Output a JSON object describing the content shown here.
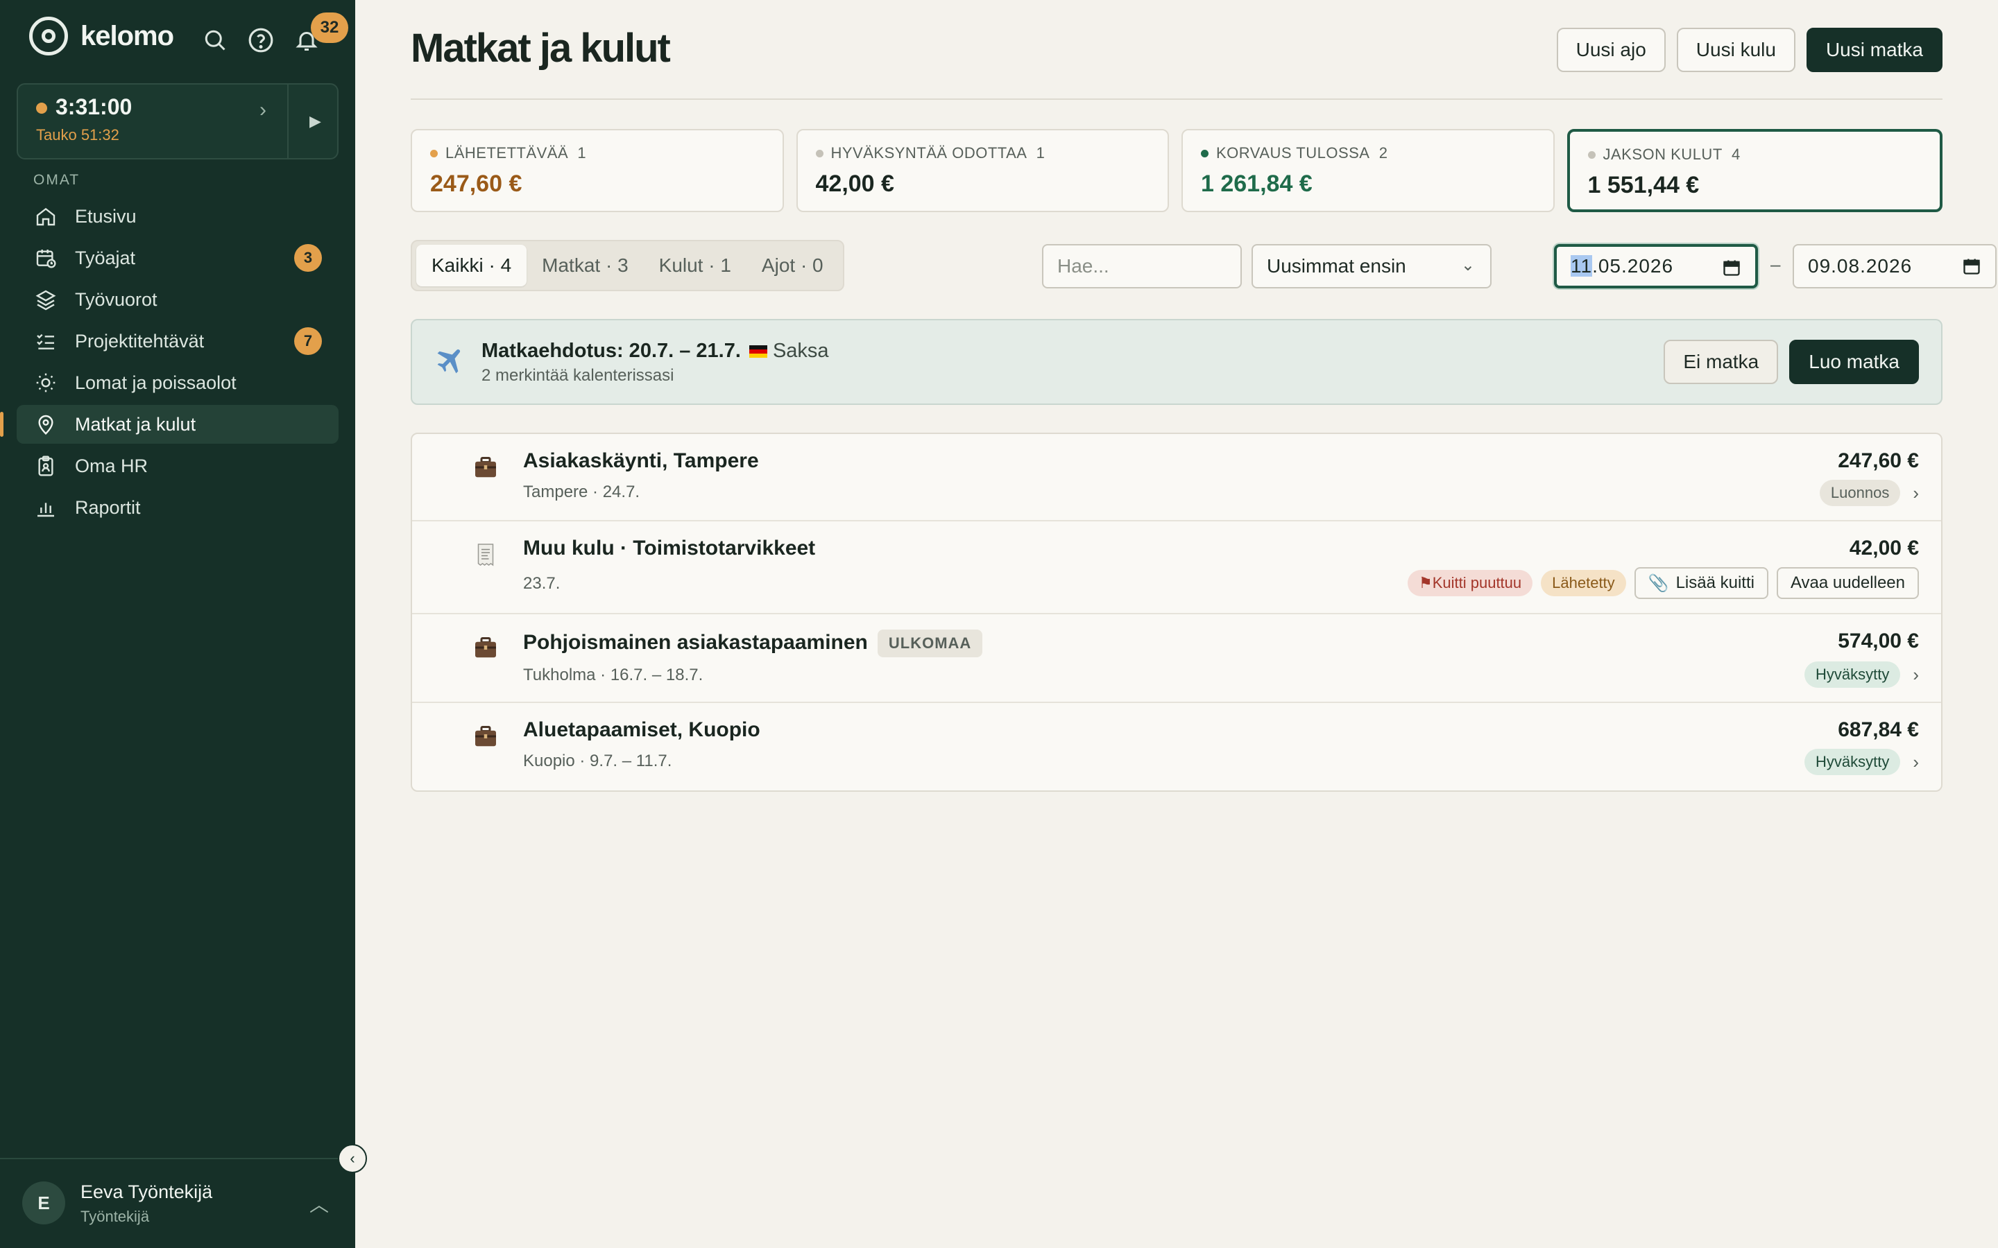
{
  "app": {
    "name": "kelomo",
    "notifications": "32"
  },
  "timer": {
    "time": "3:31:00",
    "pause": "Tauko 51:32"
  },
  "sidebar": {
    "section": "OMAT",
    "items": [
      {
        "label": "Etusivu",
        "icon": "home-icon"
      },
      {
        "label": "Työajat",
        "icon": "calendar-clock-icon",
        "badge": "3"
      },
      {
        "label": "Työvuorot",
        "icon": "layers-icon"
      },
      {
        "label": "Projektitehtävät",
        "icon": "checklist-icon",
        "badge": "7"
      },
      {
        "label": "Lomat ja poissaolot",
        "icon": "sun-icon"
      },
      {
        "label": "Matkat ja kulut",
        "icon": "map-pin-icon",
        "active": true
      },
      {
        "label": "Oma HR",
        "icon": "clipboard-icon"
      },
      {
        "label": "Raportit",
        "icon": "bar-chart-icon"
      }
    ]
  },
  "user": {
    "initial": "E",
    "name": "Eeva Työntekijä",
    "role": "Työntekijä"
  },
  "header": {
    "title": "Matkat ja kulut",
    "actions": [
      "Uusi ajo",
      "Uusi kulu",
      "Uusi matka"
    ]
  },
  "kpis": [
    {
      "label": "LÄHETETTÄVÄÄ",
      "count": "1",
      "value": "247,60 €",
      "dot": "#e3a04b",
      "color": "#9a5a18"
    },
    {
      "label": "HYVÄKSYNTÄÄ ODOTTAA",
      "count": "1",
      "value": "42,00 €",
      "dot": "#c5c2b8",
      "color": "#1a2620"
    },
    {
      "label": "KORVAUS TULOSSA",
      "count": "2",
      "value": "1 261,84 €",
      "dot": "#1f6b4a",
      "color": "#1f6b4a"
    },
    {
      "label": "JAKSON KULUT",
      "count": "4",
      "value": "1 551,44 €",
      "dot": "#c5c2b8",
      "color": "#1a2620"
    }
  ],
  "tabs": [
    "Kaikki · 4",
    "Matkat · 3",
    "Kulut · 1",
    "Ajot · 0"
  ],
  "filters": {
    "search_placeholder": "Hae...",
    "sort": "Uusimmat ensin",
    "date_from_day": "11",
    "date_from_rest": ".05.2026",
    "date_separator": "–",
    "date_to": "09.08.2026"
  },
  "suggestion": {
    "title": "Matkaehdotus: 20.7. – 21.7.",
    "country": "Saksa",
    "subtitle": "2 merkintää kalenterissasi",
    "dismiss": "Ei matka",
    "create": "Luo matka"
  },
  "rows": [
    {
      "title": "Asiakaskäynti, Tampere",
      "sub": "Tampere · 24.7.",
      "amount": "247,60 €",
      "status": "Luonnos",
      "icon": "suitcase-icon"
    },
    {
      "title": "Muu kulu · Toimistotarvikkeet",
      "sub": "23.7.",
      "amount": "42,00 €",
      "warn": "Kuitti puuttuu",
      "status": "Lähetetty",
      "add_receipt": "Lisää kuitti",
      "reopen": "Avaa uudelleen",
      "icon": "receipt-icon"
    },
    {
      "title": "Pohjoismainen asiakastapaaminen",
      "tag": "ULKOMAA",
      "sub": "Tukholma · 16.7. – 18.7.",
      "amount": "574,00 €",
      "status": "Hyväksytty",
      "icon": "suitcase-icon"
    },
    {
      "title": "Aluetapaamiset, Kuopio",
      "sub": "Kuopio · 9.7. – 11.7.",
      "amount": "687,84 €",
      "status": "Hyväksytty",
      "icon": "suitcase-icon"
    }
  ]
}
